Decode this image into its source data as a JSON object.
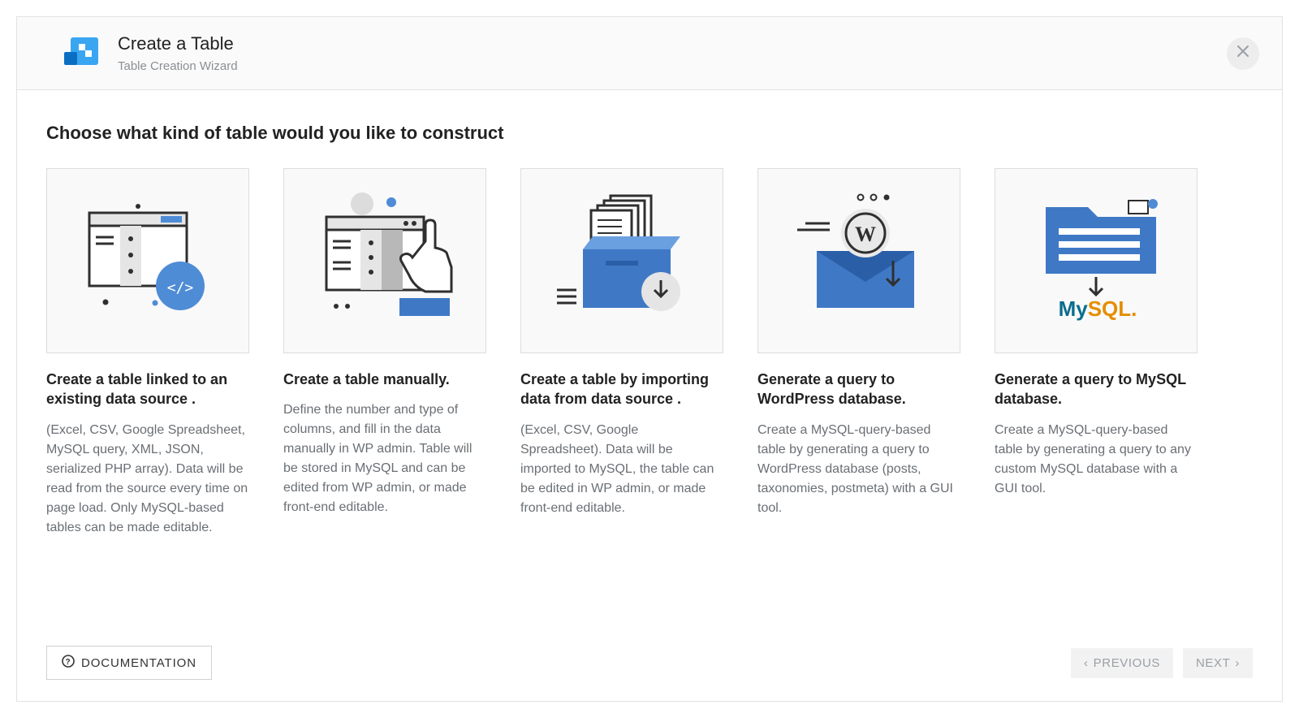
{
  "header": {
    "title": "Create a Table",
    "subtitle": "Table Creation Wizard"
  },
  "section_heading": "Choose what kind of table would you like to construct",
  "cards": [
    {
      "title": "Create a table linked to an existing data source .",
      "desc": "(Excel, CSV, Google Spreadsheet, MySQL query, XML, JSON, serialized PHP array). Data will be read from the source every time on page load. Only MySQL-based tables can be made editable."
    },
    {
      "title": "Create a table manually.",
      "desc": "Define the number and type of columns, and fill in the data manually in WP admin. Table will be stored in MySQL and can be edited from WP admin, or made front-end editable."
    },
    {
      "title": "Create a table by importing data from data source .",
      "desc": "(Excel, CSV, Google Spreadsheet). Data will be imported to MySQL, the table can be edited in WP admin, or made front-end editable."
    },
    {
      "title": "Generate a query to WordPress database.",
      "desc": "Create a MySQL-query-based table by generating a query to WordPress database (posts, taxonomies, postmeta) with a GUI tool."
    },
    {
      "title": "Generate a query to MySQL database.",
      "desc": "Create a MySQL-query-based table by generating a query to any custom MySQL database with a GUI tool."
    }
  ],
  "footer": {
    "documentation": "DOCUMENTATION",
    "previous": "PREVIOUS",
    "next": "NEXT"
  }
}
